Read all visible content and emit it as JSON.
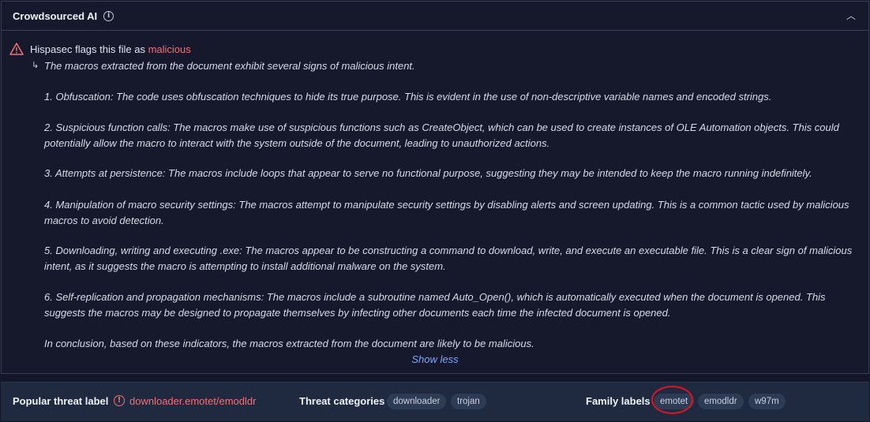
{
  "header": {
    "title": "Crowdsourced AI",
    "collapse_icon": "chevron-up-icon"
  },
  "flag": {
    "prefix": "Hispasec flags this file as ",
    "verdict": "malicious",
    "arrow": "↳"
  },
  "analysis": {
    "intro": "The macros extracted from the document exhibit several signs of malicious intent.",
    "p1": "1. Obfuscation: The code uses obfuscation techniques to hide its true purpose. This is evident in the use of non-descriptive variable names and encoded strings.",
    "p2": "2. Suspicious function calls: The macros make use of suspicious functions such as CreateObject, which can be used to create instances of OLE Automation objects. This could potentially allow the macro to interact with the system outside of the document, leading to unauthorized actions.",
    "p3": "3. Attempts at persistence: The macros include loops that appear to serve no functional purpose, suggesting they may be intended to keep the macro running indefinitely.",
    "p4": "4. Manipulation of macro security settings: The macros attempt to manipulate security settings by disabling alerts and screen updating. This is a common tactic used by malicious macros to avoid detection.",
    "p5": "5. Downloading, writing and executing .exe: The macros appear to be constructing a command to download, write, and execute an executable file. This is a clear sign of malicious intent, as it suggests the macro is attempting to install additional malware on the system.",
    "p6": "6. Self-replication and propagation mechanisms: The macros include a subroutine named Auto_Open(), which is automatically executed when the document is opened. This suggests the macros may be designed to propagate themselves by infecting other documents each time the infected document is opened.",
    "conclusion": "In conclusion, based on these indicators, the macros extracted from the document are likely to be malicious.",
    "show_less": "Show less"
  },
  "footer": {
    "popular_label": "Popular threat label",
    "popular_value": "downloader.emotet/emodldr",
    "categories_label": "Threat categories",
    "categories": [
      "downloader",
      "trojan"
    ],
    "family_label": "Family labels",
    "families": [
      "emotet",
      "emodldr",
      "w97m"
    ]
  },
  "colors": {
    "accent_red": "#f07272",
    "link_blue": "#7fa6ff",
    "annotation_circle": "#e0141e"
  }
}
